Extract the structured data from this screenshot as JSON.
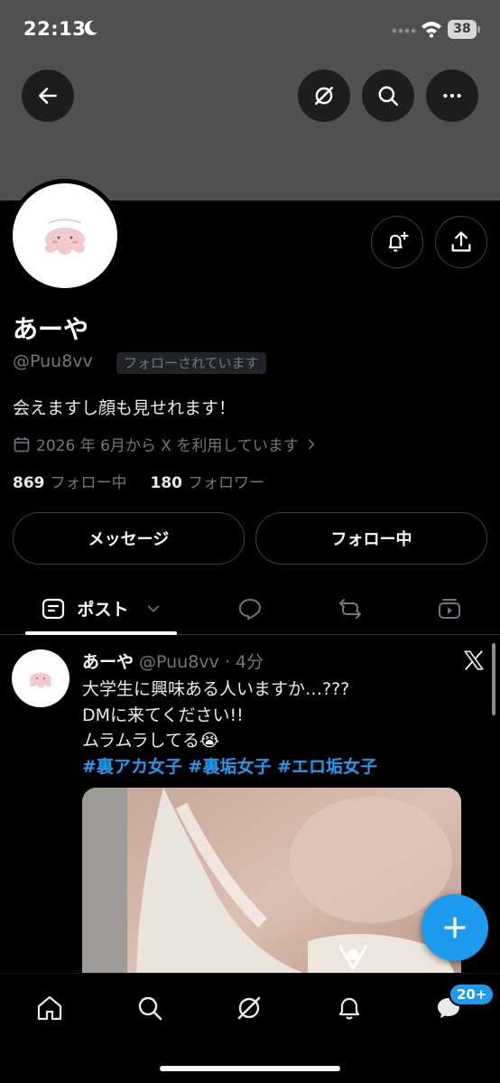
{
  "status_bar": {
    "time": "22:13",
    "battery": "38"
  },
  "profile": {
    "display_name": "あーや",
    "handle": "@Puu8vv",
    "follows_you": "フォローされています",
    "bio": "会えますし顔も見せれます！",
    "joined": "2026 年 6月から X を利用しています",
    "following_count": "869",
    "following_label": "フォロー中",
    "followers_count": "180",
    "followers_label": "フォロワー"
  },
  "actions": {
    "message": "メッセージ",
    "following": "フォロー中"
  },
  "tabs": {
    "posts": "ポスト"
  },
  "post": {
    "name": "あーや",
    "meta": "@Puu8vv · 4分",
    "line1": "大学生に興味ある人いますか…???",
    "line2": "DMに来てください!!",
    "line3": "ムラムラしてる😭",
    "hashtags": "#裏アカ女子 #裏垢女子 #エロ垢女子"
  },
  "nav": {
    "messages_badge": "20+"
  },
  "icons": {
    "back": "arrow-left-icon",
    "grok": "grok-icon",
    "search": "search-icon",
    "more": "more-icon",
    "notify": "bell-plus-icon",
    "share": "share-icon",
    "calendar": "calendar-icon",
    "home": "home-icon",
    "bell": "bell-icon",
    "messages": "messages-icon",
    "compose": "plus-icon"
  },
  "colors": {
    "accent": "#1d9bf0",
    "banner": "#505050",
    "background": "#000000"
  }
}
